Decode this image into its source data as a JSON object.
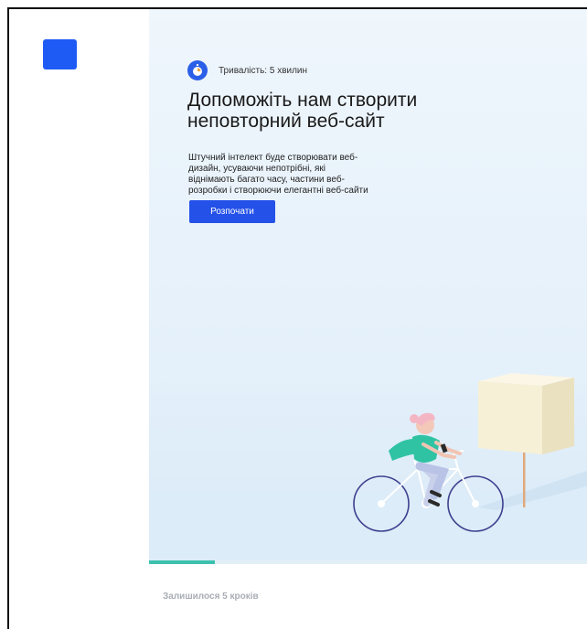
{
  "app": {
    "logo_color": "#1e5bf5",
    "accent_color": "#2451e8",
    "progress_color": "#3cc1ae"
  },
  "intro": {
    "duration_icon": "stopwatch-icon",
    "duration_text": "Тривалість: 5 хвилин",
    "headline": "Допоможіть нам створити неповторний веб-сайт",
    "description": "Штучний інтелект буде створювати веб-дизайн, усуваючи непотрібні, які віднімають багато часу, частини веб-розробки і створюючи елегантні веб-сайти",
    "start_label": "Розпочати"
  },
  "progress": {
    "fraction": 0.15,
    "steps_left_text": "Залишилося 5 кроків"
  },
  "illustration": {
    "subject": "cyclist-with-phone",
    "object": "floating-cube"
  }
}
